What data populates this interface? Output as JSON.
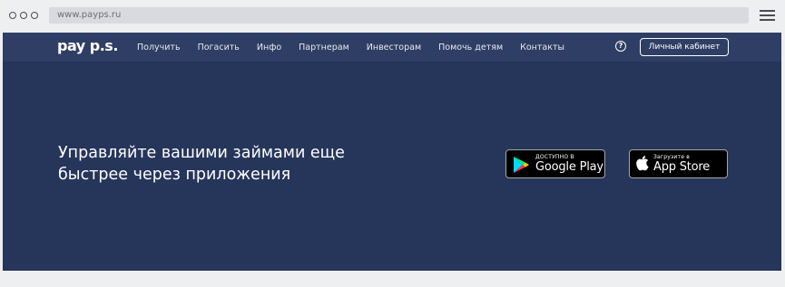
{
  "browser": {
    "url": "www.payps.ru"
  },
  "nav": {
    "logo": "pay p.s.",
    "menu": [
      "Получить",
      "Погасить",
      "Инфо",
      "Партнерам",
      "Инвесторам",
      "Помочь детям",
      "Контакты"
    ],
    "help_icon": "?",
    "cabinet_label": "Личный кабинет"
  },
  "hero": {
    "headline_line1": "Управляйте вашими займами еще",
    "headline_line2": "быстрее через приложения",
    "google_play": {
      "small": "ДОСТУПНО В",
      "big": "Google Play",
      "icon": "google-play-icon"
    },
    "app_store": {
      "small": "Загрузите в",
      "big": "App Store",
      "icon": "apple-icon"
    }
  },
  "colors": {
    "nav_bg": "#2f3e64",
    "hero_bg": "#26355a",
    "chrome_bg": "#eeeff1"
  }
}
